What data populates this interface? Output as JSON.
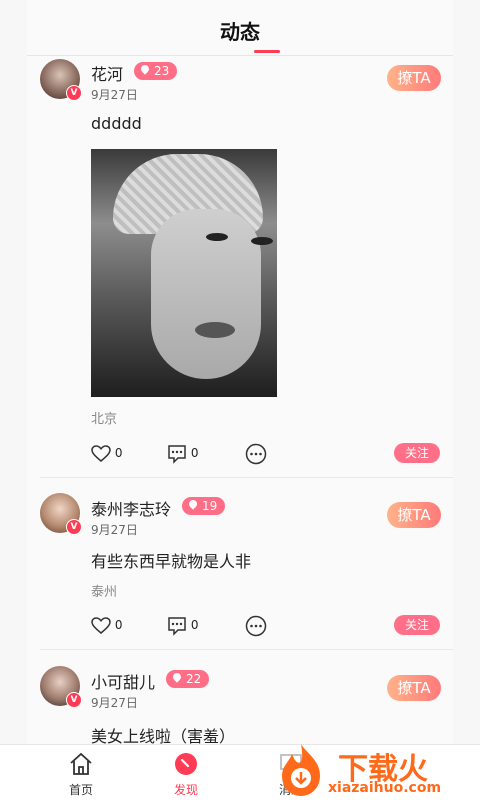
{
  "header": {
    "title": "动态"
  },
  "posts": [
    {
      "name": "花河",
      "level": "23",
      "date": "9月27日",
      "liao_label": "撩TA",
      "text": "ddddd",
      "location": "北京",
      "likes": "0",
      "comments": "0",
      "follow_label": "关注"
    },
    {
      "name": "泰州李志玲",
      "level": "19",
      "date": "9月27日",
      "liao_label": "撩TA",
      "text": "有些东西早就物是人非",
      "location": "泰州",
      "likes": "0",
      "comments": "0",
      "follow_label": "关注"
    },
    {
      "name": "小可甜儿",
      "level": "22",
      "date": "9月27日",
      "liao_label": "撩TA",
      "text": "美女上线啦（害羞）"
    }
  ],
  "verified_mark": "V",
  "tabs": [
    {
      "label": "首页",
      "icon": "home-icon"
    },
    {
      "label": "发现",
      "icon": "compass-icon",
      "active": true
    },
    {
      "label": "消息",
      "icon": "message-icon"
    }
  ],
  "watermark": {
    "brand": "下载火",
    "url": "xiazaihuo.com"
  },
  "colors": {
    "accent": "#ff3b55",
    "badge": "#ff6e86",
    "liao_gradient_start": "#ffb38a",
    "liao_gradient_end": "#ff7a7a"
  }
}
